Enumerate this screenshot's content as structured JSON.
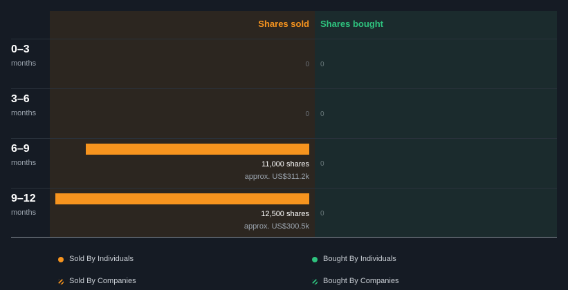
{
  "chart_data": {
    "type": "bar",
    "orientation": "horizontal",
    "categories": [
      {
        "label": "0–3",
        "unit": "months"
      },
      {
        "label": "3–6",
        "unit": "months"
      },
      {
        "label": "6–9",
        "unit": "months"
      },
      {
        "label": "9–12",
        "unit": "months"
      }
    ],
    "columns": {
      "sold": "Shares sold",
      "bought": "Shares bought"
    },
    "series": [
      {
        "name": "Shares sold",
        "values": [
          0,
          0,
          11000,
          12500
        ],
        "labels": [
          "0",
          "0",
          "11,000 shares",
          "12,500 shares"
        ],
        "value_labels": [
          "",
          "",
          "approx. US$311.2k",
          "approx. US$300.5k"
        ]
      },
      {
        "name": "Shares bought",
        "values": [
          0,
          0,
          0,
          0
        ],
        "labels": [
          "0",
          "0",
          "0",
          "0"
        ]
      }
    ],
    "max_value": 12500,
    "legend": [
      {
        "label": "Sold By Individuals",
        "color": "#f7941e",
        "style": "solid"
      },
      {
        "label": "Bought By Individuals",
        "color": "#2ec27e",
        "style": "solid"
      },
      {
        "label": "Sold By Companies",
        "color": "#f7941e",
        "style": "hatched"
      },
      {
        "label": "Bought By Companies",
        "color": "#2ec27e",
        "style": "hatched"
      }
    ],
    "legend_placement": "bottom",
    "colors": {
      "sold": "#f7941e",
      "bought": "#2ec27e"
    }
  }
}
